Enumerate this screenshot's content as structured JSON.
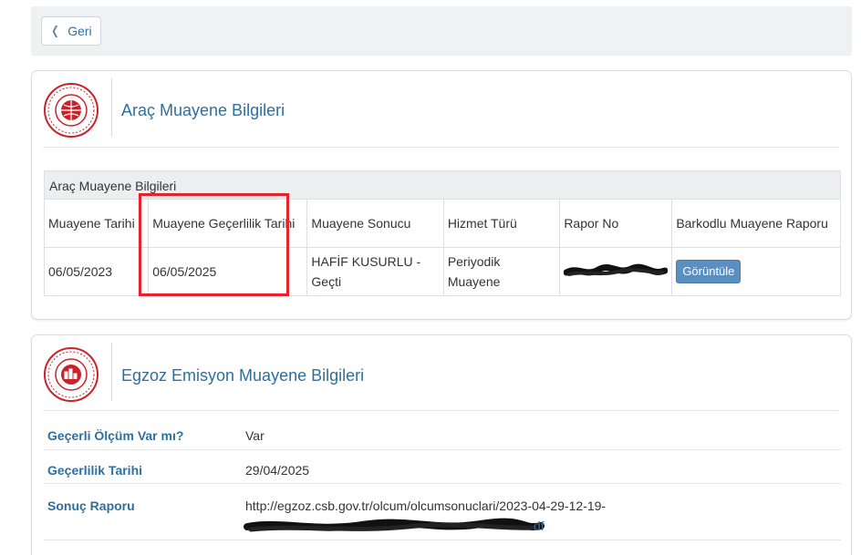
{
  "back_button": {
    "label": "Geri"
  },
  "vehicle_card": {
    "title": "Araç Muayene Bilgileri",
    "table_caption": "Araç Muayene Bilgileri",
    "columns": [
      "Muayene Tarihi",
      "Muayene Geçerlilik Tarihi",
      "Muayene Sonucu",
      "Hizmet Türü",
      "Rapor No",
      "Barkodlu Muayene Raporu"
    ],
    "row": {
      "inspection_date": "06/05/2023",
      "validity_date": "06/05/2025",
      "result": "HAFİF KUSURLU - Geçti",
      "service_type": "Periyodik Muayene",
      "report_no": "",
      "action_label": "Görüntüle"
    }
  },
  "emission_card": {
    "title": "Egzoz Emisyon Muayene Bilgileri",
    "rows": [
      {
        "label": "Geçerli Ölçüm Var mı?",
        "value": "Var"
      },
      {
        "label": "Geçerlilik Tarihi",
        "value": "29/04/2025"
      },
      {
        "label": "Sonuç Raporu",
        "value": "http://egzoz.csb.gov.tr/olcum/olcumsonuclari/2023-04-29-12-19-",
        "value_tail": "df"
      }
    ]
  },
  "colors": {
    "accent": "#2f6f9e",
    "button": "#5b8fc0",
    "highlight": "#e8212a",
    "seal": "#c8242b"
  },
  "icons": {
    "back": "chevron-left-icon",
    "logo": "ministry-seal-logo"
  }
}
